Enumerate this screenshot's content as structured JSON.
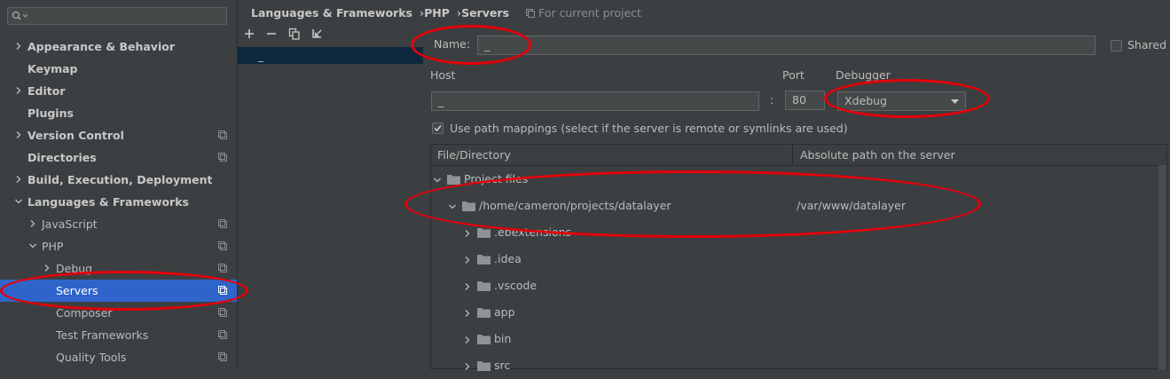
{
  "sidebar": {
    "search": {
      "value": "",
      "placeholder": ""
    },
    "items": [
      {
        "label": "Appearance & Behavior",
        "bold": true,
        "chevron": "right",
        "project": false
      },
      {
        "label": "Keymap",
        "bold": true,
        "chevron": null,
        "project": false
      },
      {
        "label": "Editor",
        "bold": true,
        "chevron": "right",
        "project": false
      },
      {
        "label": "Plugins",
        "bold": true,
        "chevron": null,
        "project": false
      },
      {
        "label": "Version Control",
        "bold": true,
        "chevron": "right",
        "project": true
      },
      {
        "label": "Directories",
        "bold": true,
        "chevron": null,
        "project": true
      },
      {
        "label": "Build, Execution, Deployment",
        "bold": true,
        "chevron": "right",
        "project": false
      },
      {
        "label": "Languages & Frameworks",
        "bold": true,
        "chevron": "down",
        "project": false
      },
      {
        "label": "JavaScript",
        "bold": false,
        "chevron": "right",
        "project": true
      },
      {
        "label": "PHP",
        "bold": false,
        "chevron": "down",
        "project": true
      },
      {
        "label": "Debug",
        "bold": false,
        "chevron": "right",
        "project": true
      },
      {
        "label": "Servers",
        "bold": false,
        "chevron": null,
        "project": true,
        "selected": true
      },
      {
        "label": "Composer",
        "bold": false,
        "chevron": null,
        "project": true
      },
      {
        "label": "Test Frameworks",
        "bold": false,
        "chevron": null,
        "project": true
      },
      {
        "label": "Quality Tools",
        "bold": false,
        "chevron": null,
        "project": true
      }
    ]
  },
  "breadcrumb": {
    "items": [
      "Languages & Frameworks",
      "PHP",
      "Servers"
    ],
    "scope": "For current project"
  },
  "server_list": {
    "toolbar": [
      "add-icon",
      "remove-icon",
      "copy-icon",
      "import-icon"
    ],
    "items": [
      "_"
    ]
  },
  "form": {
    "name_label": "Name:",
    "name_value": "_",
    "shared_label": "Shared",
    "host_label": "Host",
    "host_value": "_",
    "colon": ":",
    "port_label": "Port",
    "port_value": "80",
    "debugger_label": "Debugger",
    "debugger_value": "Xdebug",
    "path_mappings_label": "Use path mappings (select if the server is remote or symlinks are used)",
    "path_mappings_checked": true
  },
  "mappings": {
    "columns": [
      "File/Directory",
      "Absolute path on the server"
    ],
    "rows": [
      {
        "name": "Project files",
        "server_path": "",
        "chevron": "down"
      },
      {
        "name": "/home/cameron/projects/datalayer",
        "server_path": "/var/www/datalayer",
        "chevron": "down"
      },
      {
        "name": ".ebextensions",
        "server_path": "",
        "chevron": "right"
      },
      {
        "name": ".idea",
        "server_path": "",
        "chevron": "right"
      },
      {
        "name": ".vscode",
        "server_path": "",
        "chevron": "right"
      },
      {
        "name": "app",
        "server_path": "",
        "chevron": "right"
      },
      {
        "name": "bin",
        "server_path": "",
        "chevron": "right"
      },
      {
        "name": "src",
        "server_path": "",
        "chevron": "right"
      }
    ]
  },
  "colors": {
    "background": "#3c3f41",
    "selection": "#2f65ca",
    "annotation": "#e5000a"
  }
}
